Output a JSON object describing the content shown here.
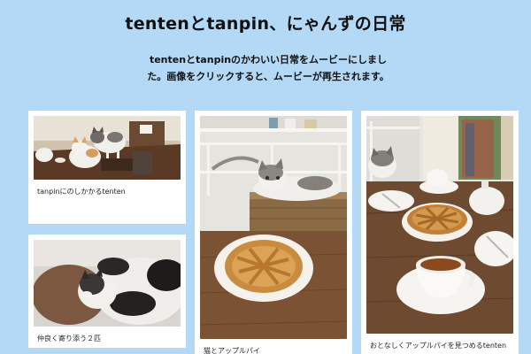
{
  "page": {
    "title": "tentenとtanpin、にゃんずの日常",
    "intro": "tentenとtanpinのかわいい日常をムービーにしました。画像をクリックすると、ムービーが再生されます。"
  },
  "cards": [
    {
      "caption": "tanpinにのしかかるtenten",
      "image": "cats-on-table-photo"
    },
    {
      "caption": "仲良く寄り添う２匹",
      "image": "cats-cuddling-photo"
    },
    {
      "caption": "猫とアップルパイ",
      "image": "cat-in-basket-apple-pie-photo"
    },
    {
      "caption": "おとなしくアップルパイを見つめるtenten",
      "image": "cat-watching-apple-pie-photo"
    }
  ],
  "colors": {
    "background": "#b3d9f7",
    "card": "#ffffff",
    "text": "#111111"
  }
}
